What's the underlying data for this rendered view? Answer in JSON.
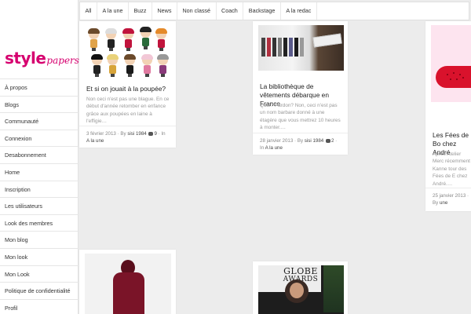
{
  "logo": {
    "style": "style",
    "papers": "papers"
  },
  "sidebar": {
    "items": [
      {
        "label": "À propos"
      },
      {
        "label": "Blogs"
      },
      {
        "label": "Communauté"
      },
      {
        "label": "Connexion"
      },
      {
        "label": "Desabonnement"
      },
      {
        "label": "Home"
      },
      {
        "label": "Inscription"
      },
      {
        "label": "Les utilisateurs"
      },
      {
        "label": "Look des membres"
      },
      {
        "label": "Mon blog"
      },
      {
        "label": "Mon look"
      },
      {
        "label": "Mon Look"
      },
      {
        "label": "Politique de confidentialité"
      },
      {
        "label": "Profil"
      }
    ]
  },
  "topnav": {
    "tabs": [
      {
        "label": "All"
      },
      {
        "label": "A la une"
      },
      {
        "label": "Buzz"
      },
      {
        "label": "News"
      },
      {
        "label": "Non classé"
      },
      {
        "label": "Coach"
      },
      {
        "label": "Backstage"
      },
      {
        "label": "A la redac"
      }
    ]
  },
  "cards": [
    {
      "title": "Et si on jouait à la poupée?",
      "excerpt": "Non ceci n'est pas une blague. En ce début d'année retomber en enfance grâce aux poupées en laine à l'effigie…",
      "date": "3 février 2013",
      "by": "· By",
      "author": "sisi 1984",
      "comments": "9",
      "in": "· In",
      "category": "A la une"
    },
    {
      "title": "La bibliothèque de vêtements débarque en France",
      "excerpt": "Quoi? Pardon? Non, ceci n'est pas un nom barbare donné à une étagère que vous mettrez 10 heures à monter.…",
      "date": "28 janvier 2013",
      "by": "· By",
      "author": "sisi 1984",
      "comments": "2",
      "in": "· In",
      "category": "A la une"
    },
    {
      "title": "Les Fées de Bo chez André",
      "excerpt": "Après Atelier Merc récemment Kanne tour des Fées de E chez André.…",
      "date": "25 janvier 2013",
      "by": "· By",
      "author": "",
      "comments": "",
      "in": "",
      "category": "une"
    }
  ],
  "banner_text": {
    "line1": "GLOBE",
    "line2": "AWARDS"
  },
  "colors": {
    "brand": "#d6006f",
    "background": "#ececec"
  }
}
